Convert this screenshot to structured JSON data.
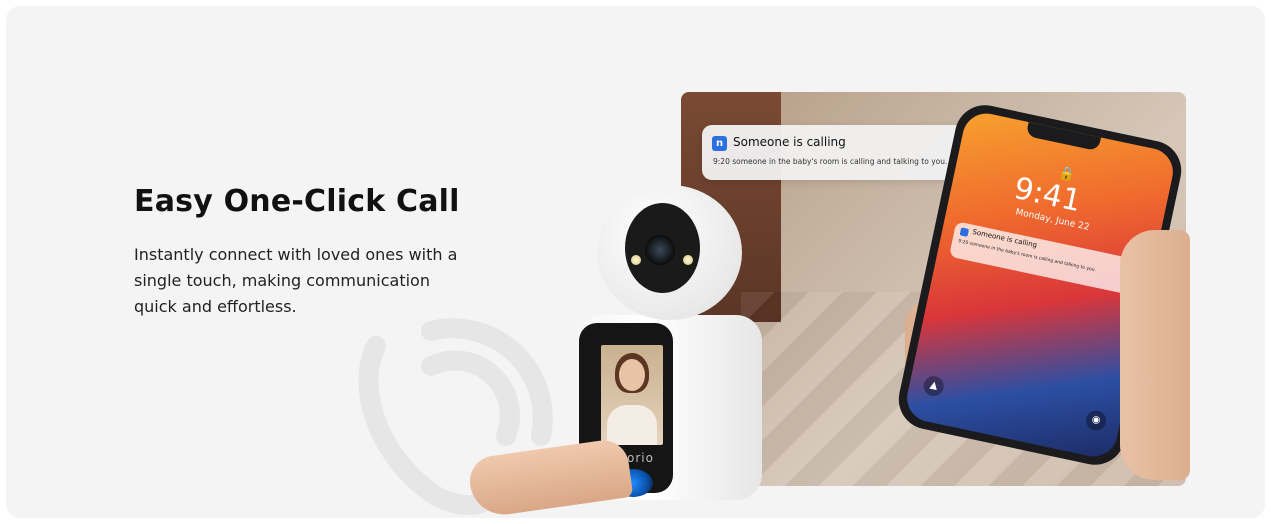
{
  "hero": {
    "title": "Easy One-Click Call",
    "description": "Instantly connect with loved ones with a single touch, making communication quick and effortless."
  },
  "notification": {
    "icon": "noorio-app-icon",
    "title": "Someone is calling",
    "body": "9:20 someone in the baby's room is calling and talking to you."
  },
  "phone": {
    "time": "9:41",
    "date": "Monday, June 22",
    "notification_title": "Someone is calling",
    "notification_body": "9:20 someone in the baby's room is calling and talking to you."
  },
  "camera": {
    "brand": "noorio"
  },
  "colors": {
    "panel_bg": "#f4f4f4",
    "title": "#111111",
    "accent_blue": "#2c6fe0"
  }
}
